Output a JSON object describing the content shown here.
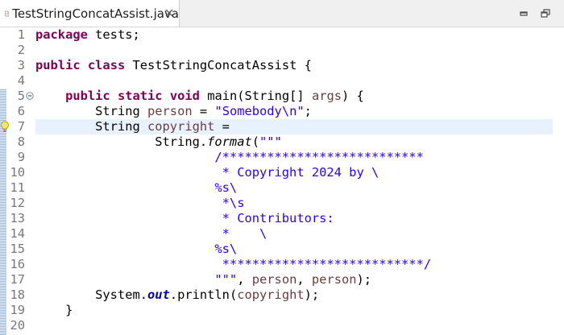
{
  "tab": {
    "title": "TestStringConcatAssist.java"
  },
  "icons": {
    "file": "java-file-icon",
    "close": "close-icon",
    "minimize": "minimize-icon",
    "maximize": "maximize-icon",
    "fold": "fold-collapse-icon",
    "quickfix": "lightbulb-icon"
  },
  "colors": {
    "keyword": "#7f0055",
    "string": "#2a00ff",
    "local_variable": "#6a3e3e",
    "static_field": "#0000c0",
    "line_number": "#787878",
    "current_line": "#e8f2fe"
  },
  "editor": {
    "current_line": 7,
    "lines": [
      {
        "n": "1",
        "segs": [
          {
            "t": "package",
            "c": "kw"
          },
          {
            "t": " tests;",
            "c": ""
          }
        ]
      },
      {
        "n": "2",
        "segs": []
      },
      {
        "n": "3",
        "segs": [
          {
            "t": "public",
            "c": "kw"
          },
          {
            "t": " ",
            "c": ""
          },
          {
            "t": "class",
            "c": "kw"
          },
          {
            "t": " TestStringConcatAssist {",
            "c": ""
          }
        ]
      },
      {
        "n": "4",
        "segs": []
      },
      {
        "n": "5",
        "segs": [
          {
            "t": "    ",
            "c": ""
          },
          {
            "t": "public",
            "c": "kw"
          },
          {
            "t": " ",
            "c": ""
          },
          {
            "t": "static",
            "c": "kw"
          },
          {
            "t": " ",
            "c": ""
          },
          {
            "t": "void",
            "c": "kw"
          },
          {
            "t": " main(String[] ",
            "c": ""
          },
          {
            "t": "args",
            "c": "var"
          },
          {
            "t": ") {",
            "c": ""
          }
        ]
      },
      {
        "n": "6",
        "segs": [
          {
            "t": "        String ",
            "c": ""
          },
          {
            "t": "person",
            "c": "var"
          },
          {
            "t": " = ",
            "c": ""
          },
          {
            "t": "\"Somebody\\n\"",
            "c": "str"
          },
          {
            "t": ";",
            "c": ""
          }
        ]
      },
      {
        "n": "7",
        "segs": [
          {
            "t": "        String ",
            "c": ""
          },
          {
            "t": "copyright",
            "c": "var"
          },
          {
            "t": " =",
            "c": ""
          }
        ]
      },
      {
        "n": "8",
        "segs": [
          {
            "t": "                String.",
            "c": ""
          },
          {
            "t": "format",
            "c": "ital"
          },
          {
            "t": "(",
            "c": ""
          },
          {
            "t": "\"\"\"",
            "c": "str"
          }
        ]
      },
      {
        "n": "9",
        "segs": [
          {
            "t": "                        ",
            "c": ""
          },
          {
            "t": "/***************************",
            "c": "str"
          }
        ]
      },
      {
        "n": "10",
        "segs": [
          {
            "t": "                        ",
            "c": ""
          },
          {
            "t": " * Copyright 2024 by \\",
            "c": "str"
          }
        ]
      },
      {
        "n": "11",
        "segs": [
          {
            "t": "                        ",
            "c": ""
          },
          {
            "t": "%s\\",
            "c": "str"
          }
        ]
      },
      {
        "n": "12",
        "segs": [
          {
            "t": "                        ",
            "c": ""
          },
          {
            "t": " *\\s",
            "c": "str"
          }
        ]
      },
      {
        "n": "13",
        "segs": [
          {
            "t": "                        ",
            "c": ""
          },
          {
            "t": " * Contributors:",
            "c": "str"
          }
        ]
      },
      {
        "n": "14",
        "segs": [
          {
            "t": "                        ",
            "c": ""
          },
          {
            "t": " *    \\",
            "c": "str"
          }
        ]
      },
      {
        "n": "15",
        "segs": [
          {
            "t": "                        ",
            "c": ""
          },
          {
            "t": "%s\\",
            "c": "str"
          }
        ]
      },
      {
        "n": "16",
        "segs": [
          {
            "t": "                        ",
            "c": ""
          },
          {
            "t": " ***************************/",
            "c": "str"
          }
        ]
      },
      {
        "n": "17",
        "segs": [
          {
            "t": "                        ",
            "c": ""
          },
          {
            "t": "\"\"\"",
            "c": "str"
          },
          {
            "t": ", ",
            "c": ""
          },
          {
            "t": "person",
            "c": "var"
          },
          {
            "t": ", ",
            "c": ""
          },
          {
            "t": "person",
            "c": "var"
          },
          {
            "t": ");",
            "c": ""
          }
        ]
      },
      {
        "n": "18",
        "segs": [
          {
            "t": "        System.",
            "c": ""
          },
          {
            "t": "out",
            "c": "field"
          },
          {
            "t": ".println(",
            "c": ""
          },
          {
            "t": "copyright",
            "c": "var"
          },
          {
            "t": ");",
            "c": ""
          }
        ]
      },
      {
        "n": "19",
        "segs": [
          {
            "t": "    }",
            "c": ""
          }
        ]
      },
      {
        "n": "20",
        "segs": []
      }
    ]
  }
}
